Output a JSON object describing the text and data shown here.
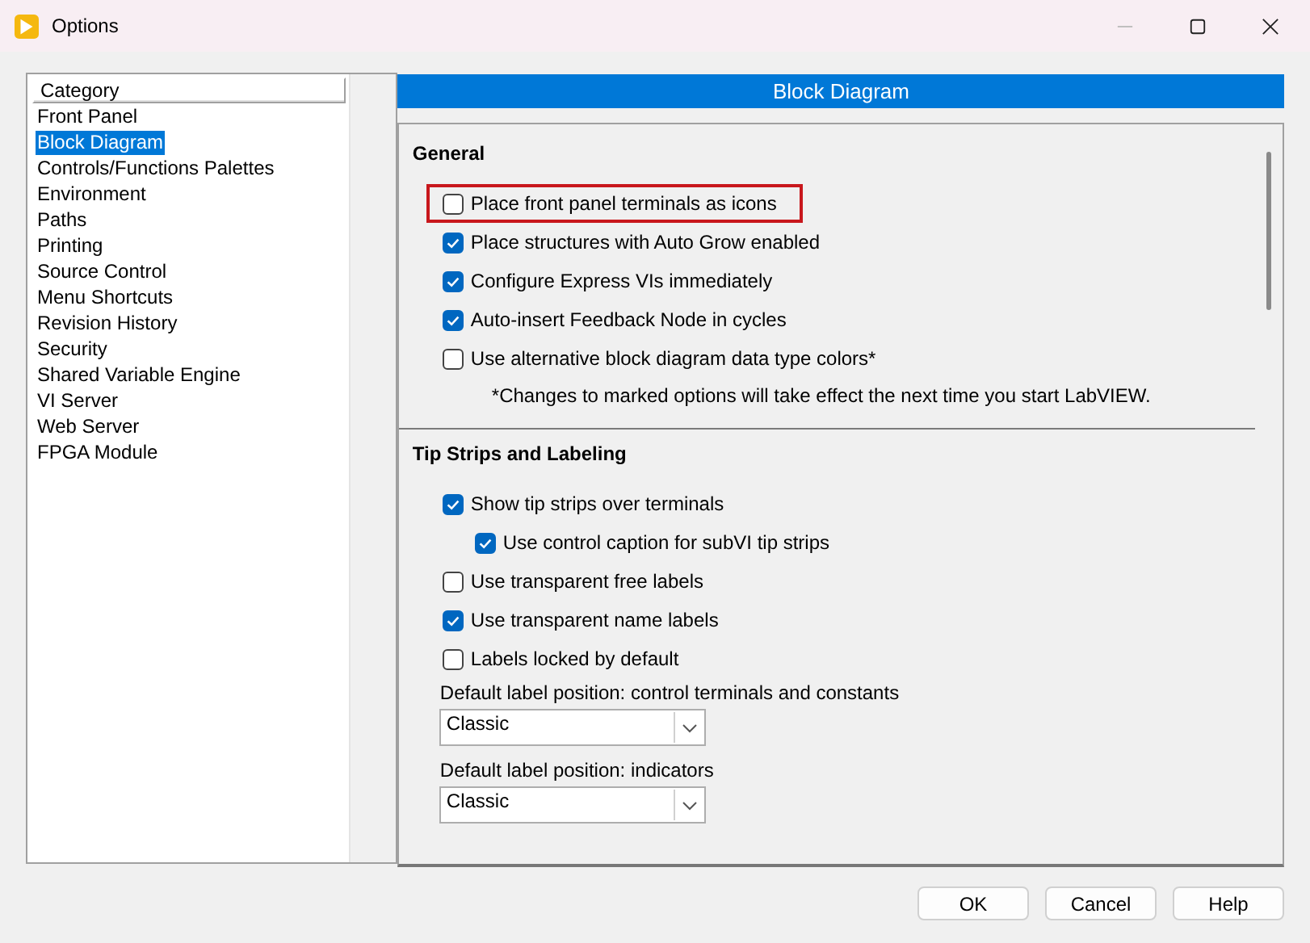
{
  "window": {
    "title": "Options"
  },
  "sidebar": {
    "header": "Category",
    "items": [
      {
        "label": "Front Panel",
        "selected": false
      },
      {
        "label": "Block Diagram",
        "selected": true
      },
      {
        "label": "Controls/Functions Palettes",
        "selected": false
      },
      {
        "label": "Environment",
        "selected": false
      },
      {
        "label": "Paths",
        "selected": false
      },
      {
        "label": "Printing",
        "selected": false
      },
      {
        "label": "Source Control",
        "selected": false
      },
      {
        "label": "Menu Shortcuts",
        "selected": false
      },
      {
        "label": "Revision History",
        "selected": false
      },
      {
        "label": "Security",
        "selected": false
      },
      {
        "label": "Shared Variable Engine",
        "selected": false
      },
      {
        "label": "VI Server",
        "selected": false
      },
      {
        "label": "Web Server",
        "selected": false
      },
      {
        "label": "FPGA Module",
        "selected": false
      }
    ]
  },
  "panel": {
    "title": "Block Diagram",
    "sections": [
      {
        "heading": "General",
        "items": [
          {
            "kind": "checkbox",
            "label": "Place front panel terminals as icons",
            "checked": false,
            "highlighted": true
          },
          {
            "kind": "checkbox",
            "label": "Place structures with Auto Grow enabled",
            "checked": true
          },
          {
            "kind": "checkbox",
            "label": "Configure Express VIs immediately",
            "checked": true
          },
          {
            "kind": "checkbox",
            "label": "Auto-insert Feedback Node in cycles",
            "checked": true
          },
          {
            "kind": "checkbox",
            "label": "Use alternative block diagram data type colors*",
            "checked": false
          },
          {
            "kind": "note",
            "text": "*Changes to marked options will take effect the next time you start LabVIEW."
          }
        ]
      },
      {
        "heading": "Tip Strips and Labeling",
        "items": [
          {
            "kind": "checkbox",
            "label": "Show tip strips over terminals",
            "checked": true,
            "children": [
              {
                "kind": "checkbox",
                "label": "Use control caption for subVI tip strips",
                "checked": true
              }
            ]
          },
          {
            "kind": "checkbox",
            "label": "Use transparent free labels",
            "checked": false
          },
          {
            "kind": "checkbox",
            "label": "Use transparent name labels",
            "checked": true
          },
          {
            "kind": "checkbox",
            "label": "Labels locked by default",
            "checked": false
          },
          {
            "kind": "dropdown",
            "label": "Default label position: control terminals and constants",
            "value": "Classic"
          },
          {
            "kind": "dropdown",
            "label": "Default label position: indicators",
            "value": "Classic"
          }
        ]
      }
    ]
  },
  "buttons": [
    "OK",
    "Cancel",
    "Help"
  ]
}
